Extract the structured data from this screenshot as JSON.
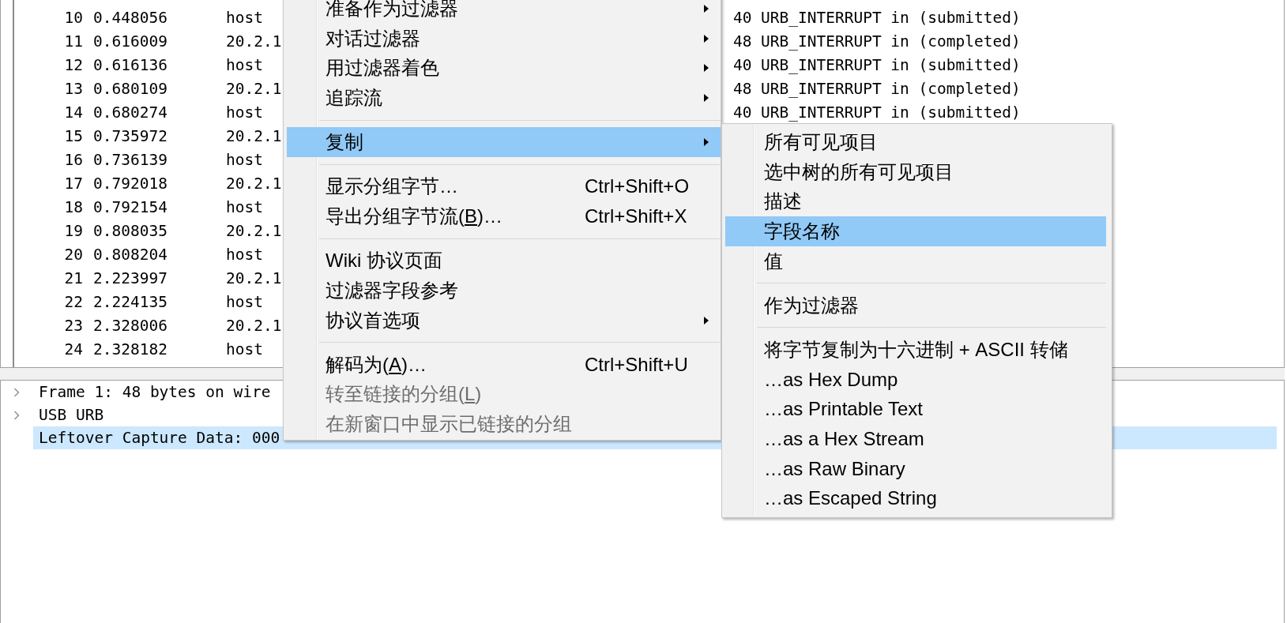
{
  "packet_list": {
    "rows": [
      {
        "no": "10",
        "time": "0.448056",
        "source": "host",
        "length": "40",
        "info": "URB_INTERRUPT in (submitted)"
      },
      {
        "no": "11",
        "time": "0.616009",
        "source": "20.2.1",
        "length": "48",
        "info": "URB_INTERRUPT in (completed)"
      },
      {
        "no": "12",
        "time": "0.616136",
        "source": "host",
        "length": "40",
        "info": "URB_INTERRUPT in (submitted)"
      },
      {
        "no": "13",
        "time": "0.680109",
        "source": "20.2.1",
        "length": "48",
        "info": "URB_INTERRUPT in (completed)"
      },
      {
        "no": "14",
        "time": "0.680274",
        "source": "host",
        "length": "40",
        "info": "URB_INTERRUPT in (submitted)"
      },
      {
        "no": "15",
        "time": "0.735972",
        "source": "20.2.1"
      },
      {
        "no": "16",
        "time": "0.736139",
        "source": "host"
      },
      {
        "no": "17",
        "time": "0.792018",
        "source": "20.2.1"
      },
      {
        "no": "18",
        "time": "0.792154",
        "source": "host"
      },
      {
        "no": "19",
        "time": "0.808035",
        "source": "20.2.1"
      },
      {
        "no": "20",
        "time": "0.808204",
        "source": "host"
      },
      {
        "no": "21",
        "time": "2.223997",
        "source": "20.2.1"
      },
      {
        "no": "22",
        "time": "2.224135",
        "source": "host"
      },
      {
        "no": "23",
        "time": "2.328006",
        "source": "20.2.1"
      },
      {
        "no": "24",
        "time": "2.328182",
        "source": "host"
      }
    ]
  },
  "packet_details": {
    "items": [
      {
        "label": "Frame 1: 48 bytes on wire",
        "kind": "node",
        "expanded": false,
        "selected": false
      },
      {
        "label": "USB URB",
        "kind": "node",
        "expanded": false,
        "selected": false
      },
      {
        "label": "Leftover Capture Data: 000",
        "kind": "leaf",
        "selected": true
      }
    ]
  },
  "context_menu": {
    "groups": [
      {
        "items": [
          {
            "label": "准备作为过滤器",
            "kind": "submenu",
            "selected": false,
            "disabled": false
          },
          {
            "label": "对话过滤器",
            "kind": "submenu",
            "selected": false,
            "disabled": false
          },
          {
            "label": "用过滤器着色",
            "kind": "submenu",
            "selected": false,
            "disabled": false
          },
          {
            "label": "追踪流",
            "kind": "submenu",
            "selected": false,
            "disabled": false
          }
        ]
      },
      {
        "items": [
          {
            "label": "复制",
            "kind": "submenu",
            "selected": true,
            "disabled": false
          }
        ]
      },
      {
        "items": [
          {
            "label": "显示分组字节…",
            "kind": "command",
            "shortcut": "Ctrl+Shift+O",
            "selected": false,
            "disabled": false
          },
          {
            "label": "导出分组字节流(",
            "access_key": "B",
            "label_tail": ")…",
            "kind": "command",
            "shortcut": "Ctrl+Shift+X",
            "selected": false,
            "disabled": false
          }
        ]
      },
      {
        "items": [
          {
            "label": "Wiki 协议页面",
            "kind": "command",
            "selected": false,
            "disabled": false
          },
          {
            "label": "过滤器字段参考",
            "kind": "command",
            "selected": false,
            "disabled": false
          },
          {
            "label": "协议首选项",
            "kind": "submenu",
            "selected": false,
            "disabled": false
          }
        ]
      },
      {
        "items": [
          {
            "label": "解码为(",
            "access_key": "A",
            "label_tail": ")…",
            "kind": "command",
            "shortcut": "Ctrl+Shift+U",
            "selected": false,
            "disabled": false
          },
          {
            "label": "转至链接的分组(",
            "access_key": "L",
            "label_tail": ")",
            "kind": "command",
            "selected": false,
            "disabled": true
          },
          {
            "label": "在新窗口中显示已链接的分组",
            "kind": "command",
            "selected": false,
            "disabled": true
          }
        ]
      }
    ]
  },
  "copy_submenu": {
    "groups": [
      {
        "items": [
          {
            "label": "所有可见项目",
            "selected": false,
            "disabled": false
          },
          {
            "label": "选中树的所有可见项目",
            "selected": false,
            "disabled": false
          },
          {
            "label": "描述",
            "selected": false,
            "disabled": false
          },
          {
            "label": "字段名称",
            "selected": true,
            "disabled": false
          },
          {
            "label": "值",
            "selected": false,
            "disabled": false
          }
        ]
      },
      {
        "items": [
          {
            "label": "作为过滤器",
            "selected": false,
            "disabled": false
          }
        ]
      },
      {
        "items": [
          {
            "label": "将字节复制为十六进制 + ASCII 转储",
            "selected": false,
            "disabled": false
          },
          {
            "label": "…as Hex Dump",
            "selected": false,
            "disabled": false
          },
          {
            "label": "…as Printable Text",
            "selected": false,
            "disabled": false
          },
          {
            "label": "…as a Hex Stream",
            "selected": false,
            "disabled": false
          },
          {
            "label": "…as Raw Binary",
            "selected": false,
            "disabled": false
          },
          {
            "label": "…as Escaped String",
            "selected": false,
            "disabled": false
          }
        ]
      }
    ]
  }
}
